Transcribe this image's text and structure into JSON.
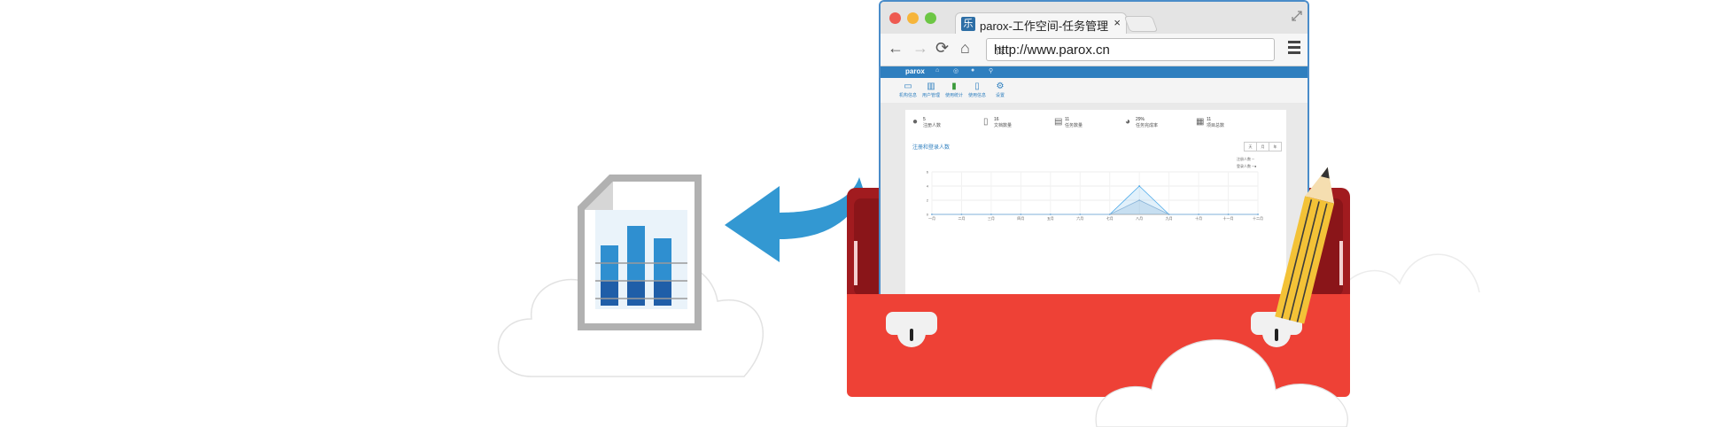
{
  "browser": {
    "tab_title": "parox-工作空间-任务管理",
    "favicon_glyph": "乐",
    "tab_close": "×",
    "url": "http://www.parox.cn",
    "traffic_light_colors": [
      "#ee5a51",
      "#f6b53b",
      "#6cc644"
    ]
  },
  "app": {
    "logo": "parox",
    "topnav_icons": [
      "home-icon",
      "dashboard-icon",
      "user-icon",
      "search-icon"
    ],
    "subnav": [
      {
        "label": "机构信息",
        "icon": "card-icon"
      },
      {
        "label": "用户管理",
        "icon": "id-icon"
      },
      {
        "label": "使用统计",
        "icon": "bar-chart-icon"
      },
      {
        "label": "使用信息",
        "icon": "document-icon"
      },
      {
        "label": "设置",
        "icon": "gear-icon"
      }
    ],
    "stats": [
      {
        "value": "5",
        "label": "注册人数",
        "icon": "user-icon"
      },
      {
        "value": "16",
        "label": "文档数量",
        "icon": "document-icon"
      },
      {
        "value": "11",
        "label": "任务数量",
        "icon": "stack-icon"
      },
      {
        "value": "29%",
        "label": "任务完成率",
        "icon": "pie-icon"
      },
      {
        "value": "11",
        "label": "项目总数",
        "icon": "building-icon"
      }
    ],
    "chart_title": "注册和登录人数",
    "range_buttons": [
      "天",
      "月",
      "年"
    ],
    "legend": [
      "注册人数",
      "登录人数"
    ]
  },
  "chart_data": {
    "type": "line",
    "title": "注册和登录人数",
    "categories": [
      "一月",
      "二月",
      "三月",
      "四月",
      "五月",
      "六月",
      "七月",
      "八月",
      "九月",
      "十月",
      "十一月",
      "十二月"
    ],
    "series": [
      {
        "name": "注册人数",
        "values": [
          0,
          0,
          0,
          0,
          0,
          0,
          0,
          2,
          0,
          0,
          0,
          0
        ]
      },
      {
        "name": "登录人数",
        "values": [
          0,
          0,
          0,
          0,
          0,
          0,
          0,
          4,
          0,
          0,
          0,
          0
        ]
      }
    ],
    "yticks": [
      "0",
      "2",
      "4",
      "6"
    ],
    "ylim": [
      0,
      6
    ],
    "grid": true,
    "legend_position": "top-right"
  },
  "colors": {
    "accent_blue": "#3a97d0",
    "toolbox_red": "#ee4136",
    "toolbox_dark_red": "#a11b1f",
    "pencil_yellow": "#f3c237"
  }
}
